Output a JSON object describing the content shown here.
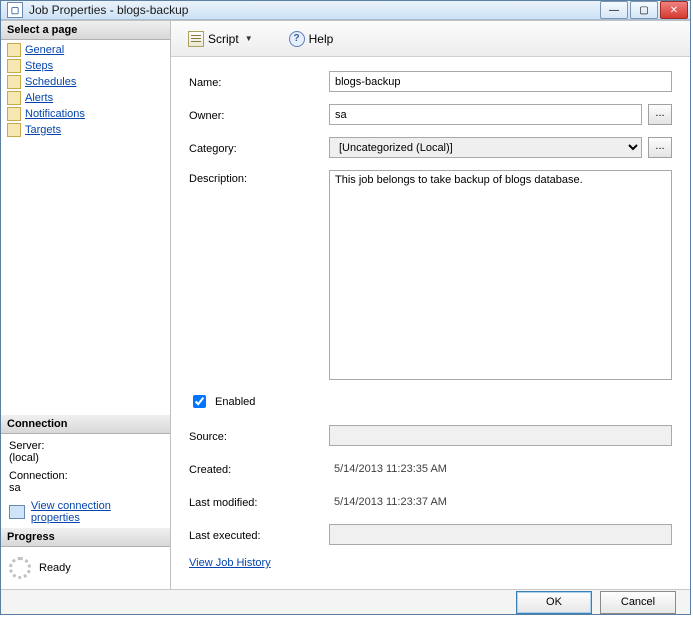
{
  "titlebar": {
    "title": "Job Properties - blogs-backup"
  },
  "sidebar": {
    "select_page_header": "Select a page",
    "pages": [
      {
        "label": "General"
      },
      {
        "label": "Steps"
      },
      {
        "label": "Schedules"
      },
      {
        "label": "Alerts"
      },
      {
        "label": "Notifications"
      },
      {
        "label": "Targets"
      }
    ],
    "connection_header": "Connection",
    "server_label": "Server:",
    "server_value": "(local)",
    "connection_label": "Connection:",
    "connection_value": "sa",
    "view_conn_props": "View connection properties",
    "progress_header": "Progress",
    "progress_status": "Ready"
  },
  "toolbar": {
    "script_label": "Script",
    "help_label": "Help"
  },
  "form": {
    "name_label": "Name:",
    "name_value": "blogs-backup",
    "owner_label": "Owner:",
    "owner_value": "sa",
    "category_label": "Category:",
    "category_value": "[Uncategorized (Local)]",
    "description_label": "Description:",
    "description_value": "This job belongs to take backup of blogs database.",
    "enabled_label": "Enabled",
    "enabled_checked": true,
    "source_label": "Source:",
    "source_value": "",
    "created_label": "Created:",
    "created_value": "5/14/2013 11:23:35 AM",
    "modified_label": "Last modified:",
    "modified_value": "5/14/2013 11:23:37 AM",
    "executed_label": "Last executed:",
    "executed_value": "",
    "view_history": "View Job History"
  },
  "footer": {
    "ok": "OK",
    "cancel": "Cancel"
  }
}
